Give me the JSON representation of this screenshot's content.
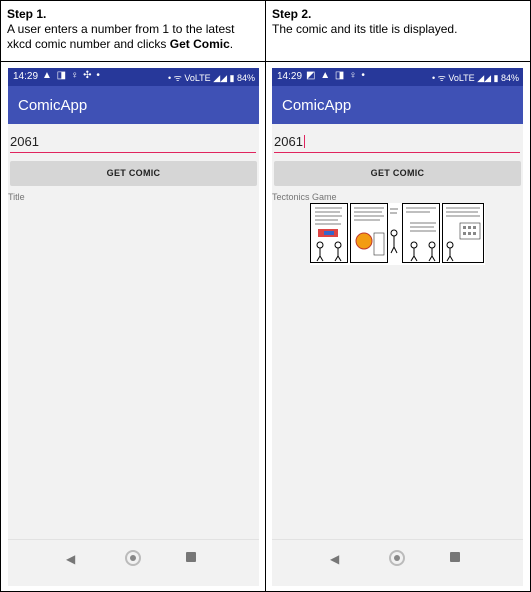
{
  "steps": [
    {
      "heading": "Step 1.",
      "description_before": "A user enters a number from 1 to the latest xkcd comic number and clicks ",
      "description_bold": "Get Comic",
      "description_after": ".",
      "phone": {
        "status_time": "14:29",
        "status_left_icons": "▲ ◨ ♀ ✣ •",
        "status_right": "• ᯤ VoLTE ◢◢ ▮ 84%",
        "app_title": "ComicApp",
        "input_value": "2061",
        "button_label": "GET COMIC",
        "comic_title": "Title",
        "comic_image_shown": false
      }
    },
    {
      "heading": "Step 2.",
      "description_before": "The comic and its title is displayed.",
      "description_bold": "",
      "description_after": "",
      "phone": {
        "status_time": "14:29",
        "status_left_icons": "◩ ▲ ◨ ♀ •",
        "status_right": "• ᯤ VoLTE ◢◢ ▮ 84%",
        "app_title": "ComicApp",
        "input_value": "2061",
        "button_label": "GET COMIC",
        "comic_title": "Tectonics Game",
        "comic_image_shown": true,
        "comic_icon": "xkcd-comic-image"
      }
    }
  ],
  "nav_icons": [
    "back-icon",
    "home-icon",
    "recents-icon"
  ]
}
